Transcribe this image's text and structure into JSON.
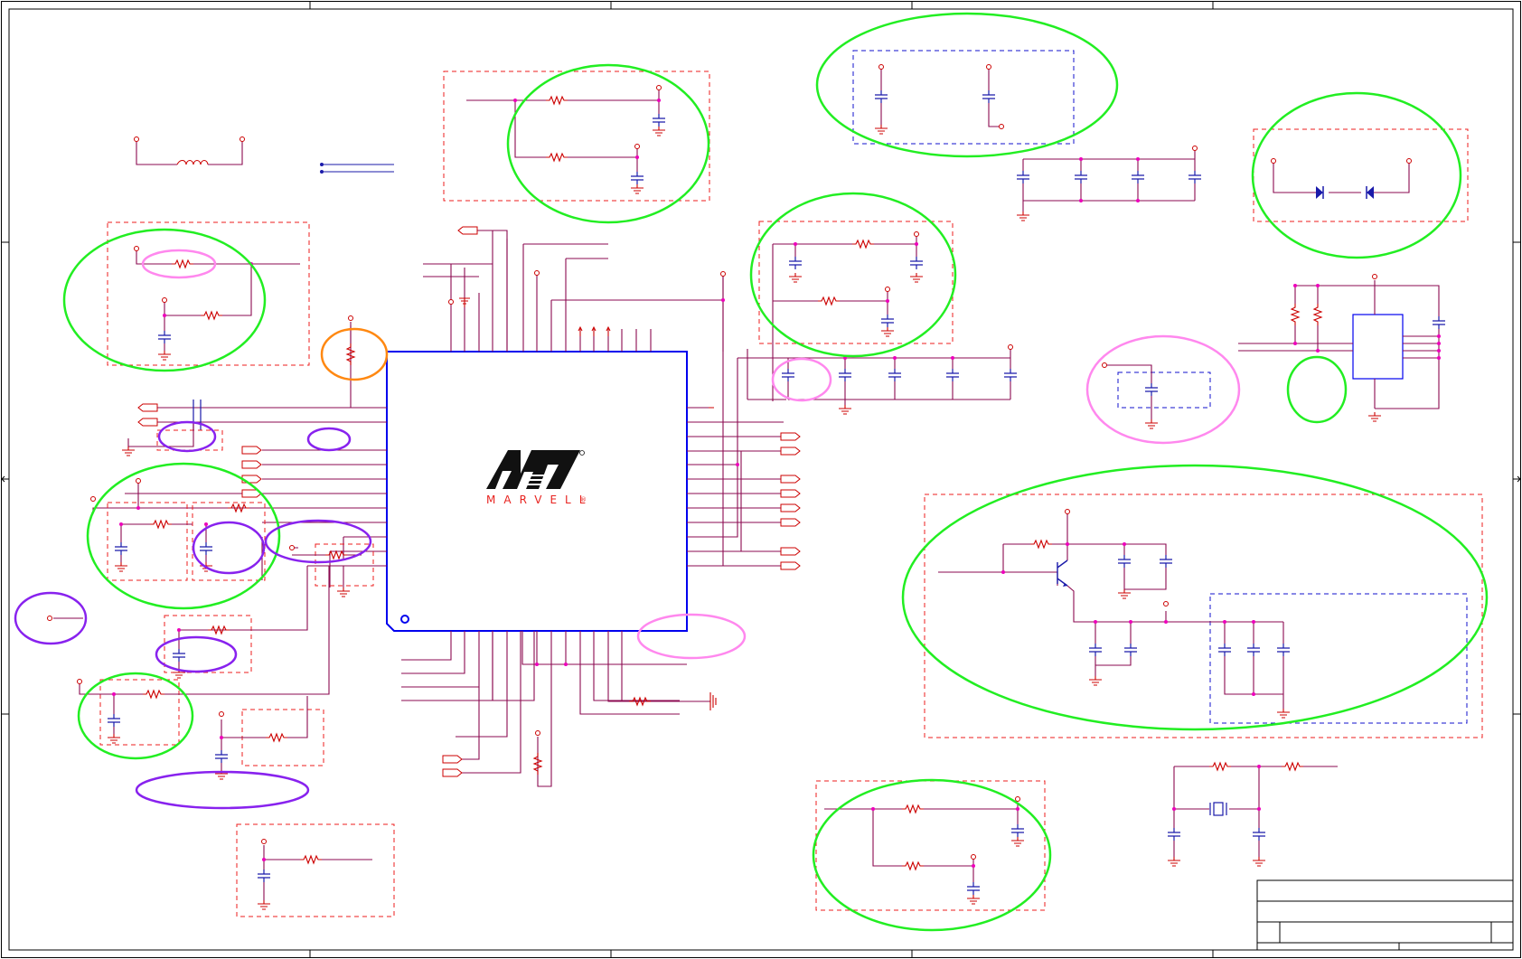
{
  "logo": {
    "text": "MARVELL",
    "mark": "®"
  },
  "colors": {
    "wire": "#8b0a50",
    "component": "#cc0000",
    "chip_outline": "#0000ee",
    "subcircuit_box": "#ee1c1c",
    "subcircuit_box_alt": "#1010cc",
    "highlight_green": "#22ee22",
    "highlight_pink": "#ff88ee",
    "highlight_purple": "#8822ee",
    "highlight_orange": "#ff8811",
    "logo_red": "#e8231f",
    "frame": "#000000",
    "junction": "#ee00bb"
  },
  "icons": {
    "logo_icon": "marvell-logo-icon",
    "pin1_marker": "pin1-circle-icon"
  }
}
